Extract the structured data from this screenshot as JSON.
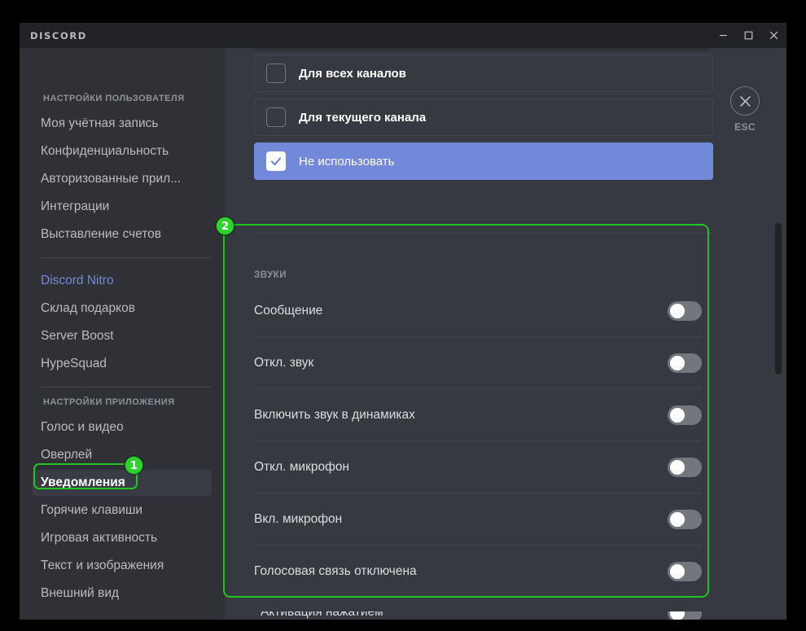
{
  "window": {
    "brand": "DISCORD",
    "controls": {
      "minimize": "minimize",
      "maximize": "maximize",
      "close": "close"
    }
  },
  "esc": {
    "label": "ESC",
    "icon": "close-x-icon"
  },
  "sidebar": {
    "sections": [
      {
        "header": "НАСТРОЙКИ ПОЛЬЗОВАТЕЛЯ",
        "items": [
          {
            "label": "Моя учётная запись",
            "state": "normal"
          },
          {
            "label": "Конфиденциальность",
            "state": "normal"
          },
          {
            "label": "Авторизованные прил...",
            "state": "normal"
          },
          {
            "label": "Интеграции",
            "state": "normal"
          },
          {
            "label": "Выставление счетов",
            "state": "normal"
          }
        ]
      },
      {
        "header": "",
        "items": [
          {
            "label": "Discord Nitro",
            "state": "nitro"
          },
          {
            "label": "Склад подарков",
            "state": "normal"
          },
          {
            "label": "Server Boost",
            "state": "normal"
          },
          {
            "label": "HypeSquad",
            "state": "normal"
          }
        ]
      },
      {
        "header": "НАСТРОЙКИ ПРИЛОЖЕНИЯ",
        "items": [
          {
            "label": "Голос и видео",
            "state": "normal"
          },
          {
            "label": "Оверлей",
            "state": "normal"
          },
          {
            "label": "Уведомления",
            "state": "active"
          },
          {
            "label": "Горячие клавиши",
            "state": "normal"
          },
          {
            "label": "Игровая активность",
            "state": "normal"
          },
          {
            "label": "Текст и изображения",
            "state": "normal"
          },
          {
            "label": "Внешний вид",
            "state": "normal"
          }
        ]
      }
    ]
  },
  "main": {
    "checkbox_options": [
      {
        "label": "Для всех каналов",
        "checked": false
      },
      {
        "label": "Для текущего канала",
        "checked": false
      },
      {
        "label": "Не использовать",
        "checked": true
      }
    ],
    "sounds": {
      "title": "ЗВУКИ",
      "rows": [
        {
          "label": "Сообщение",
          "enabled": false
        },
        {
          "label": "Откл. звук",
          "enabled": false
        },
        {
          "label": "Включить звук в динамиках",
          "enabled": false
        },
        {
          "label": "Откл. микрофон",
          "enabled": false
        },
        {
          "label": "Вкл. микрофон",
          "enabled": false
        },
        {
          "label": "Голосовая связь отключена",
          "enabled": false
        }
      ],
      "clipped_row": {
        "label": "Активация нажатием",
        "enabled": false
      }
    }
  },
  "annotations": {
    "markers": [
      {
        "number": "1",
        "target": "sidebar-item-notifications"
      },
      {
        "number": "2",
        "target": "sounds-section"
      }
    ],
    "color": "#21c521"
  },
  "scrollbar": {
    "position_percent": 31
  }
}
